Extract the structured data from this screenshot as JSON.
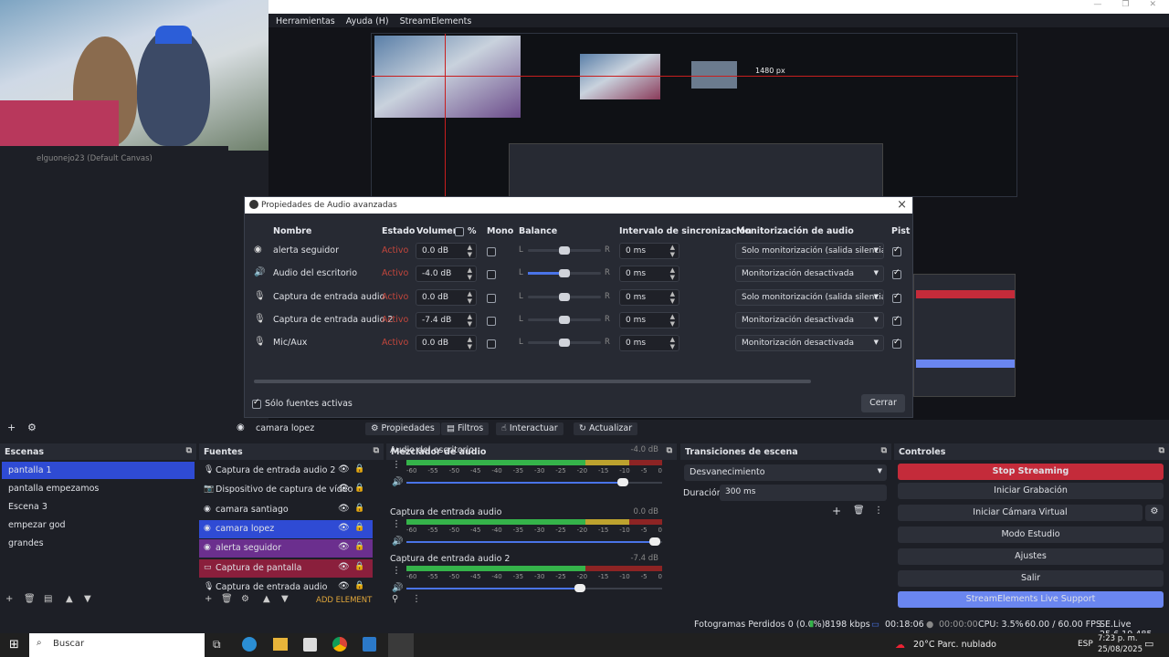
{
  "menu": {
    "items": [
      "Herramientas",
      "Ayuda (H)",
      "StreamElements"
    ]
  },
  "preview": {
    "caption": "elguonejo23 (Default Canvas)",
    "size_label": "1480 px"
  },
  "dialog": {
    "title": "Propiedades de Audio avanzadas",
    "headers": {
      "name": "Nombre",
      "state": "Estado",
      "volume": "Volumen",
      "percent": "%",
      "mono": "Mono",
      "balance": "Balance",
      "sync": "Intervalo de sincronización",
      "monitor": "Monitorización de audio",
      "tracks": "Pist"
    },
    "rows": [
      {
        "name": "alerta seguidor",
        "state": "Activo",
        "volume": "0.0 dB",
        "mono": false,
        "bal_l": "L",
        "bal_r": "R",
        "sync": "0 ms",
        "monitor": "Solo monitorización (salida silencia",
        "track": true
      },
      {
        "name": "Audio del escritorio",
        "state": "Activo",
        "volume": "-4.0 dB",
        "mono": false,
        "bal_l": "L",
        "bal_r": "R",
        "sync": "0 ms",
        "monitor": "Monitorización desactivada",
        "track": true
      },
      {
        "name": "Captura de entrada audio",
        "state": "Activo",
        "volume": "0.0 dB",
        "mono": false,
        "bal_l": "L",
        "bal_r": "R",
        "sync": "0 ms",
        "monitor": "Solo monitorización (salida silencia",
        "track": true
      },
      {
        "name": "Captura de entrada audio 2",
        "state": "Activo",
        "volume": "-7.4 dB",
        "mono": false,
        "bal_l": "L",
        "bal_r": "R",
        "sync": "0 ms",
        "monitor": "Monitorización desactivada",
        "track": true
      },
      {
        "name": "Mic/Aux",
        "state": "Activo",
        "volume": "0.0 dB",
        "mono": false,
        "bal_l": "L",
        "bal_r": "R",
        "sync": "0 ms",
        "monitor": "Monitorización desactivada",
        "track": true
      }
    ],
    "only_active": "Sólo fuentes activas",
    "close": "Cerrar"
  },
  "source_toolbar": {
    "current": "camara lopez",
    "properties": "Propiedades",
    "filters": "Filtros",
    "interact": "Interactuar",
    "refresh": "Actualizar"
  },
  "scenes": {
    "title": "Escenas",
    "items": [
      "pantalla 1",
      "pantalla empezamos",
      "Escena 3",
      "empezar god",
      "grandes"
    ]
  },
  "sources": {
    "title": "Fuentes",
    "items": [
      "Captura de entrada audio 2",
      "Dispositivo de captura de vídeo",
      "camara santiago",
      "camara lopez",
      "alerta seguidor",
      "Captura de pantalla",
      "Captura de entrada audio"
    ],
    "add_element": "ADD ELEMENT"
  },
  "mixer": {
    "title": "Mezclador de audio",
    "channels": [
      {
        "name": "Audio del escritorio",
        "db": "-4.0 dB",
        "level": 0.87
      },
      {
        "name": "Captura de entrada audio",
        "db": "0.0 dB",
        "level": 1.0
      },
      {
        "name": "Captura de entrada audio 2",
        "db": "-7.4 dB",
        "level": 0.7
      }
    ],
    "ticks": [
      "-60",
      "-55",
      "-50",
      "-45",
      "-40",
      "-35",
      "-30",
      "-25",
      "-20",
      "-15",
      "-10",
      "-5",
      "0"
    ]
  },
  "transitions": {
    "title": "Transiciones de escena",
    "current": "Desvanecimiento",
    "duration_label": "Duración",
    "duration": "300 ms"
  },
  "controls": {
    "title": "Controles",
    "stop_streaming": "Stop Streaming",
    "start_recording": "Iniciar Grabación",
    "virtual_cam": "Iniciar Cámara Virtual",
    "studio": "Modo Estudio",
    "settings": "Ajustes",
    "exit": "Salir",
    "support": "StreamElements Live Support"
  },
  "status": {
    "dropped": "Fotogramas Perdidos 0 (0.0%)",
    "bitrate": "8198 kbps",
    "stream_time": "00:18:06",
    "rec_time": "00:00:00",
    "cpu": "CPU: 3.5%",
    "fps": "60.00 / 60.00 FPS",
    "version": "SE.Live 25.6.19.485"
  },
  "taskbar": {
    "search": "Buscar",
    "weather": "20°C  Parc. nublado",
    "lang": "ESP",
    "time": "7:23 p. m.",
    "date": "25/08/2025"
  },
  "colors": {
    "accent": "#2f4bd4",
    "stop": "#c42b3a",
    "support": "#6a86f0"
  }
}
